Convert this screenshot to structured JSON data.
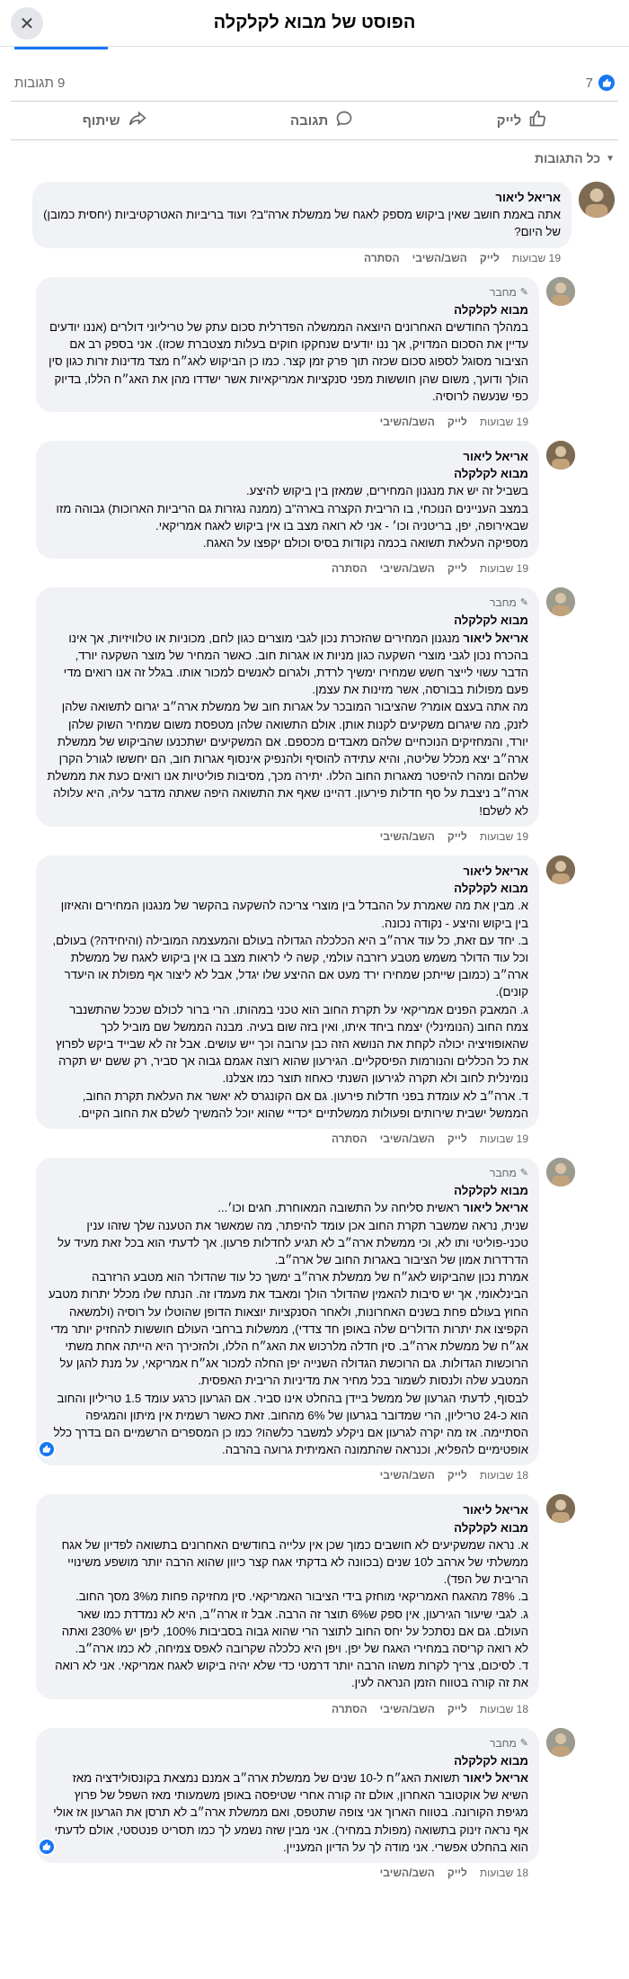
{
  "header": {
    "title": "הפוסט של מבוא לקלקלה"
  },
  "stats": {
    "likes": "7",
    "comments": "9 תגובות"
  },
  "actions": {
    "like": "לייק",
    "comment": "תגובה",
    "share": "שיתוף"
  },
  "filter": {
    "label": "כל התגובות"
  },
  "labels": {
    "author_badge": "מחבר",
    "like": "לייק",
    "reply": "השב/השיבי",
    "hide": "הסתרה"
  },
  "comments": [
    {
      "author": "אריאל ליאור",
      "tagline": "",
      "badge": "",
      "time": "19 שבועות",
      "hide": true,
      "text": "אתה באמת חושב שאין ביקוש מספק לאגח של ממשלת ארה\"ב? ועוד בריביות האטרקטיביות (יחסית כמובן) של היום?"
    },
    {
      "author": "מבוא לקלקלה",
      "tagline": "",
      "badge": "מחבר",
      "time": "19 שבועות",
      "hide": false,
      "text": "במהלך החודשים האחרונים היוצאה הממשלה הפדרלית סכום עתק של טריליוני דולרים (אננו יודעים עדיין את הסכום המדויק, אך ננו יודעים שנחקקו חוקים בעלות מצטברת שכזו). אני בספק רב אם הציבור מסוגל לספוג סכום שכזה תוך פרק זמן קצר. כמו כן הביקוש לאג״ח מצד מדינות זרות כגון סין הולך ודועך, משום שהן חוששות מפני סנקציות אמריקאיות אשר ישדדו מהן את האג״ח הללו, בדיוק כפי שנעשה לרוסיה."
    },
    {
      "author": "אריאל ליאור",
      "tagline": "מבוא לקלקלה",
      "badge": "",
      "time": "19 שבועות",
      "hide": true,
      "text": "בשביל זה יש את מנגנון המחירים, שמאזן בין ביקוש להיצע.\nבמצב העניינים הנוכחי, בו הריבית הקצרה בארה\"ב (ממנה נגזרות גם הריביות הארוכות) גבוהה מזו שבאירופה, יפן, בריטניה וכו׳ - אני לא רואה מצב בו אין ביקוש לאגח אמריקאי.\nמספיקה העלאת תשואה בכמה נקודות בסיס וכולם יקפצו על האגח."
    },
    {
      "author": "מבוא לקלקלה",
      "tagline": "",
      "badge": "מחבר",
      "time": "19 שבועות",
      "hide": false,
      "mention": "אריאל ליאור",
      "text": " מנגנון המחירים שהזכרת נכון לגבי מוצרים כגון לחם, מכוניות או טלוויזיות, אך אינו בהכרח נכון לגבי מוצרי השקעה כגון מניות או אגרות חוב. כאשר המחיר של מוצר השקעה יורד, הדבר עשוי לייצר חשש שמחירו ימשיך לרדת, ולגרום לאנשים למכור אותו. בגלל זה אנו רואים מדי פעם מפולות בבורסה, אשר מזינות את עצמן.\nמה אתה בעצם אומר? שהציבור המובכר על אגרות חוב של ממשלת ארה״ב יגרום לתשואה שלהן לזנק, מה שיגרום משקיעים לקנות אותן. אולם התשואה שלהן מטפסת משום שמחיר השוק שלהן יורד, והמחזיקים הנוכחיים שלהם מאבדים מכספם. אם המשקיעים ישתכנעו שהביקוש של ממשלת ארה״ב יצא מכלל שליטה, והיא עתידה להוסיף ולהנפיק אינסוף אגרות חוב, הם יחששו לגורל הקרן שלהם ומהרו להיפטר מאגרות החוב הללו. יתירה מכך, מסיבות פוליטיות אנו רואים כעת את ממשלת ארה״ב ניצבת על סף חדלות פירעון. דהיינו שאף את התשואה היפה שאתה מדבר עליה, היא עלולה לא לשלם!"
    },
    {
      "author": "אריאל ליאור",
      "tagline": "מבוא לקלקלה",
      "badge": "",
      "time": "19 שבועות",
      "hide": true,
      "text": "א. מבין את מה שאמרת על ההבדל בין מוצרי צריכה להשקעה בהקשר של מנגנון המחירים והאיזון בין ביקוש והיצע - נקודה נכונה.\nב. יחד עם זאת, כל עוד ארה״ב היא הכלכלה הגדולה בעולם והמעצמה המובילה (והיחידה?) בעולם, וכל עוד הדולר משמש מטבע רזרבה עולמי, קשה לי לראות מצב בו אין ביקוש לאגח של ממשלת ארה״ב (כמובן שייתכן שמחירו ירד מעט אם ההיצע שלו יגדל, אבל לא ליצור אף מפולת או היעדר קונים).\nג. המאבק הפנים אמריקאי על תקרת החוב הוא טכני במהותו. הרי ברור לכולם שככל שהתשנבר צמח החוב (הנומינלי) יצמח ביחד איתו, ואין בזה שום בעיה. מבנה הממשל שם מוביל לכך שהאופוזיציה יכולה לקחת את הנושא הזה כבן ערובה וכך ייש עושים. אבל זה לא שבייד ביקש לפרוץ את כל הכללים והנורמות הפיסקליים. הגירעון שהוא רוצה אגמם גבוה אך סביר, רק ששם יש תקרה נומינלית לחוב ולא תקרה לגירעון השנתי כאחוז תוצר כמו אצלנו.\nד. ארה״ב לא עומדת בפני חדלות פירעון. גם אם הקונגרס לא יאשר את העלאת תקרת החוב, הממשל ישבית שירותים ופעולות ממשלתיים *כדי* שהוא יוכל להמשיך לשלם את החוב הקיים."
    },
    {
      "author": "מבוא לקלקלה",
      "tagline": "",
      "badge": "מחבר",
      "time": "18 שבועות",
      "hide": false,
      "mention": "אריאל ליאור",
      "react": true,
      "text": " ראשית סליחה על התשובה המאוחרת. חגים וכו׳...\nשנית, נראה שמשבר תקרת החוב אכן עומד להיפתר, מה שמאשר את הטענה שלך שזהו ענין טכני-פוליטי ותו לא, וכי ממשלת ארה״ב לא תגיע לחדלות פרעון. אך לדעתי הוא בכל זאת מעיד על הדרדרות אמון של הציבור באגרות החוב של ארה״ב.\nאמרת נכון שהביקוש לאג״ח של ממשלת ארה״ב ימשך כל עוד שהדולר הוא מטבע הרזרבה הבינלאומי, אך יש סיבות להאמין שהדולר הולך ומאבד את מעמדו זה. הנתח שלו מכלל יתרות מטבע החוץ בעולם פחת בשנים האחרונות, ולאחר הסנקציות יוצאות הדופן שהוטלו על רוסיה (ולמשאה הקפיצו את יתרות הדולרים שלה באופן חד צדדי), ממשלות ברחבי העולם חוששות להחזיק יותר מדי אג״ח של ממשלת ארה״ב. סין חדלה מלרכוש את האג״ח הללו, ולהזכירך היא הייתה אחת משתי הרוכשות הגדולות. גם הרוכשת הגדולה השנייה יפן החלה למכור אג״ח אמריקאי, על מנת להגן על המטבע שלה ולנסות לשמור בכל מחיר את מדיניות הריבית האפסית.\nלבסוף, לדעתי הגרעון של ממשל ביידן בהחלט אינו סביר. אם הגרעון כרגע עומד 1.5 טריליון והחוב הוא כ-24 טריליון, הרי שמדובר בגרעון של 6% מהחוב. זאת כאשר רשמית אין מיתון והמגיפה הסתיימה. אז מה יקרה לגרעון אם ניקלע למשבר כלשהו? כמו כן המספרים הרשמיים הם בדרך כלל אופטימיים להפליא, וכנראה שהתמונה האמיתית גרועה בהרבה."
    },
    {
      "author": "אריאל ליאור",
      "tagline": "מבוא לקלקלה",
      "badge": "",
      "time": "18 שבועות",
      "hide": true,
      "text": "א. נראה שמשקיעים לא חושבים כמוך שכן אין עלייה בחודשים האחרונים בתשואה לפדיון של אגח ממשלתי של ארהב ל10 שנים (בכוונה לא בדקתי אגח קצר כיוון שהוא הרבה יותר מושפע משינויי הריבית של הפד).\nב. 78% מהאגח האמריקאי מוחזק בידי הציבור האמריקאי. סין מחזיקה פחות מ3% מסך החוב.\nג. לגבי שיעור הגירעון, אין ספק ש6% תוצר זה הרבה. אבל זו ארה״ב, היא לא נמדדת כמו שאר העולם. גם אם נסתכל על יחס החוב לתוצר הרי שהוא גבוה בסביבות 100%, ליפן יש 230% ואתה לא רואה קריסה במחירי האגח של יפן. ויפן היא כלכלה שקרובה לאפס צמיחה, לא כמו ארה״ב.\nד. לסיכום, צריך לקרות משהו הרבה יותר דרמטי כדי שלא יהיה ביקוש לאגח אמריקאי. אני לא רואה את זה קורה בטווח הזמן הנראה לעין."
    },
    {
      "author": "מבוא לקלקלה",
      "tagline": "",
      "badge": "מחבר",
      "time": "18 שבועות",
      "hide": false,
      "mention": "אריאל ליאור",
      "react": true,
      "text": " תשואת האג״ח ל-10 שנים של ממשלת ארה״ב אמנם נמצאת בקונסולידציה מאז השיא של אוקטובר האחרון, אולם זה קורה אחרי שטיפסה באופן משמעותי מאז השפל של פרוץ מגיפת הקורונה. בטווח הארוך אני צופה שתטפס, ואם ממשלת ארה״ב לא תרסן את הגרעון אז אולי אף נראה זינוק בתשואה (מפולת במחיר). אני מבין שזה נשמע לך כמו תסריט פנטסטי, אולם לדעתי הוא בהחלט אפשרי. אני מודה לך על הדיון המעניין."
    }
  ]
}
